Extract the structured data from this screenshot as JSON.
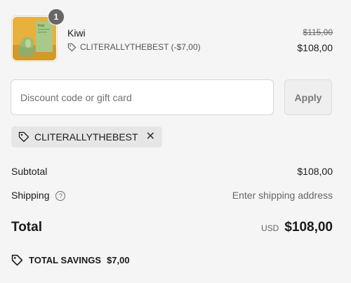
{
  "product": {
    "quantity": "1",
    "name": "Kiwi",
    "discount_label": "CLITERALLYTHEBEST (-$7,00)",
    "price_original": "$115,00",
    "price_current": "$108,00",
    "thumbnail_text": "Kiwi"
  },
  "discount": {
    "placeholder": "Discount code or gift card",
    "apply_label": "Apply",
    "applied_code": "CLITERALLYTHEBEST"
  },
  "summary": {
    "subtotal_label": "Subtotal",
    "subtotal_value": "$108,00",
    "shipping_label": "Shipping",
    "shipping_value": "Enter shipping address",
    "total_label": "Total",
    "currency": "USD",
    "total_value": "$108,00",
    "savings_label": "TOTAL SAVINGS",
    "savings_value": "$7,00"
  }
}
